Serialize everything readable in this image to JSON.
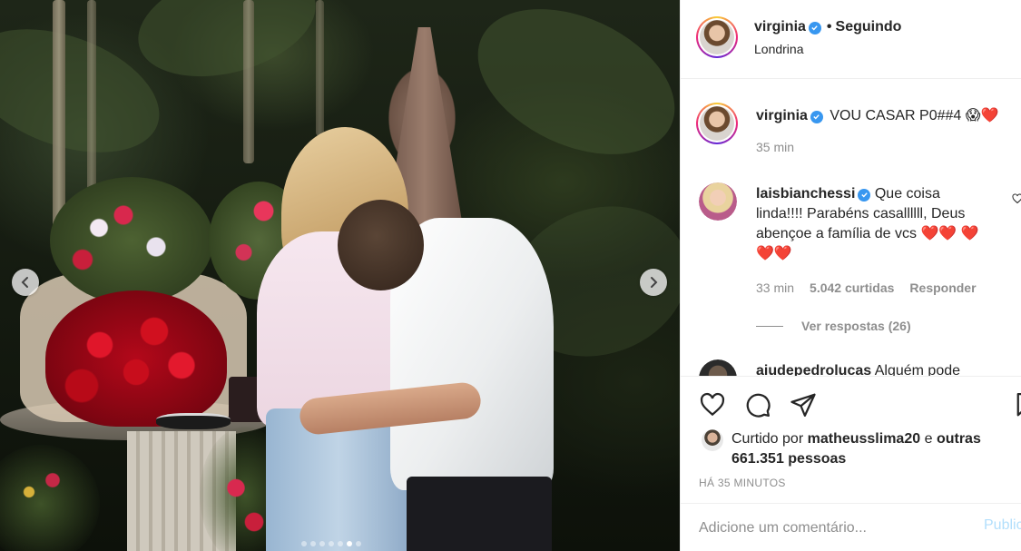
{
  "post": {
    "author": "virginia",
    "location": "Londrina",
    "follow_sep": "•",
    "follow_label": "Seguindo",
    "carousel": {
      "total_slides": 7,
      "active_slide": 6
    }
  },
  "caption": {
    "username": "virginia",
    "text": "VOU CASAR P0##4",
    "emoji": "😱❤️",
    "time": "35 min"
  },
  "comment": {
    "username": "laisbianchessi",
    "text": "Que coisa linda!!!! Parabéns casallllll, Deus abençoe a família de vcs ❤️❤️ ❤️❤️❤️",
    "time": "33 min",
    "likes": "5.042 curtidas",
    "reply_label": "Responder",
    "view_replies": "Ver respostas (26)"
  },
  "next_comment": {
    "username": "aiudepedrolucas",
    "text": "Alguém pode"
  },
  "likes": {
    "prefix": "Curtido por",
    "user": "matheusslima20",
    "connector": "e",
    "others": "outras 661.351 pessoas"
  },
  "timestamp": "HÁ 35 MINUTOS",
  "add_comment": {
    "placeholder": "Adicione um comentário...",
    "publish_label": "Publicar"
  },
  "colors": {
    "verified": "#3897f0",
    "publish_disabled": "#b2dffc",
    "muted": "#8e8e8e"
  },
  "icons": [
    "verified-icon",
    "heart-icon",
    "comment-icon",
    "share-icon",
    "bookmark-icon",
    "chevron-left-icon",
    "chevron-right-icon"
  ]
}
